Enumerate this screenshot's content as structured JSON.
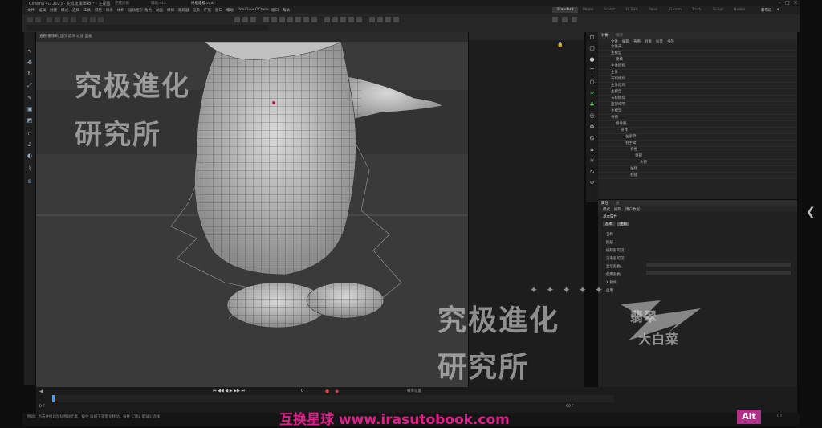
{
  "window": {
    "title": "Cinema 4D 2023 · 完成建模.c4d * - 主视图",
    "tabs": [
      "主模型",
      "完成建模",
      "辅助.c4d",
      "终极建模.c4d *"
    ]
  },
  "menu": {
    "items": [
      "文件",
      "编辑",
      "创建",
      "模式",
      "选择",
      "工具",
      "网格",
      "样条",
      "体积",
      "运动图形",
      "角色",
      "动画",
      "模拟",
      "跟踪器",
      "渲染",
      "扩展",
      "窗口",
      "帮助",
      "RealFlow",
      "OCtane",
      "窗口",
      "帮助"
    ],
    "layouts": [
      "Standard",
      "Model",
      "Sculpt",
      "UV Edit",
      "Paint",
      "Groom",
      "Track",
      "Script",
      "Nodes"
    ],
    "right": [
      "新布局",
      "▾"
    ]
  },
  "viewport": {
    "label": "透视视图",
    "camera": "默认摄像机"
  },
  "object_manager": {
    "tabs": [
      "对象",
      "场次"
    ],
    "menu": [
      "文件",
      "编辑",
      "查看",
      "对象",
      "标签",
      "书签"
    ],
    "rows": [
      "文件夹",
      "主模型",
      "建模",
      "主体结构",
      "主体",
      "布料模拟",
      "主体结构",
      "主模型",
      "布料模拟",
      "面部细节",
      "主模型",
      "骨骼",
      "根骨骼",
      "身体",
      "左手臂",
      "右手臂",
      "脊椎",
      "颈部",
      "头部",
      "左腿",
      "右腿"
    ]
  },
  "attributes": {
    "tabs": [
      "属性",
      "层"
    ],
    "menu": [
      "模式",
      "编辑",
      "用户数据"
    ],
    "section": "基本属性",
    "subtabs": [
      "基本",
      "坐标"
    ],
    "labels": [
      "名称",
      "图层",
      "编辑器可见",
      "渲染器可见",
      "显示颜色",
      "使用颜色",
      "X 射线",
      "启用"
    ]
  },
  "timeline": {
    "frame_start": "0 F",
    "frame_end": "90 F",
    "current": "0",
    "fps_label": "帧率设置"
  },
  "status": {
    "hint": "移动：点击并拖动鼠标移动元素，按住 SHIFT 键量化移动；按住 CTRL 键减少选择",
    "frame": "0 F"
  },
  "watermarks": {
    "top_left_1": "究极進化",
    "top_left_2": "研究所",
    "bottom_1": "究极進化",
    "bottom_2": "研究所",
    "logo_text_1": "翡翠",
    "logo_text_2": "大白菜",
    "url_cn": "互换星球",
    "url": "www.irasutobook.com",
    "alt": "Alt",
    "stars": "✦ ✦ ✦ ✦ ✦"
  }
}
